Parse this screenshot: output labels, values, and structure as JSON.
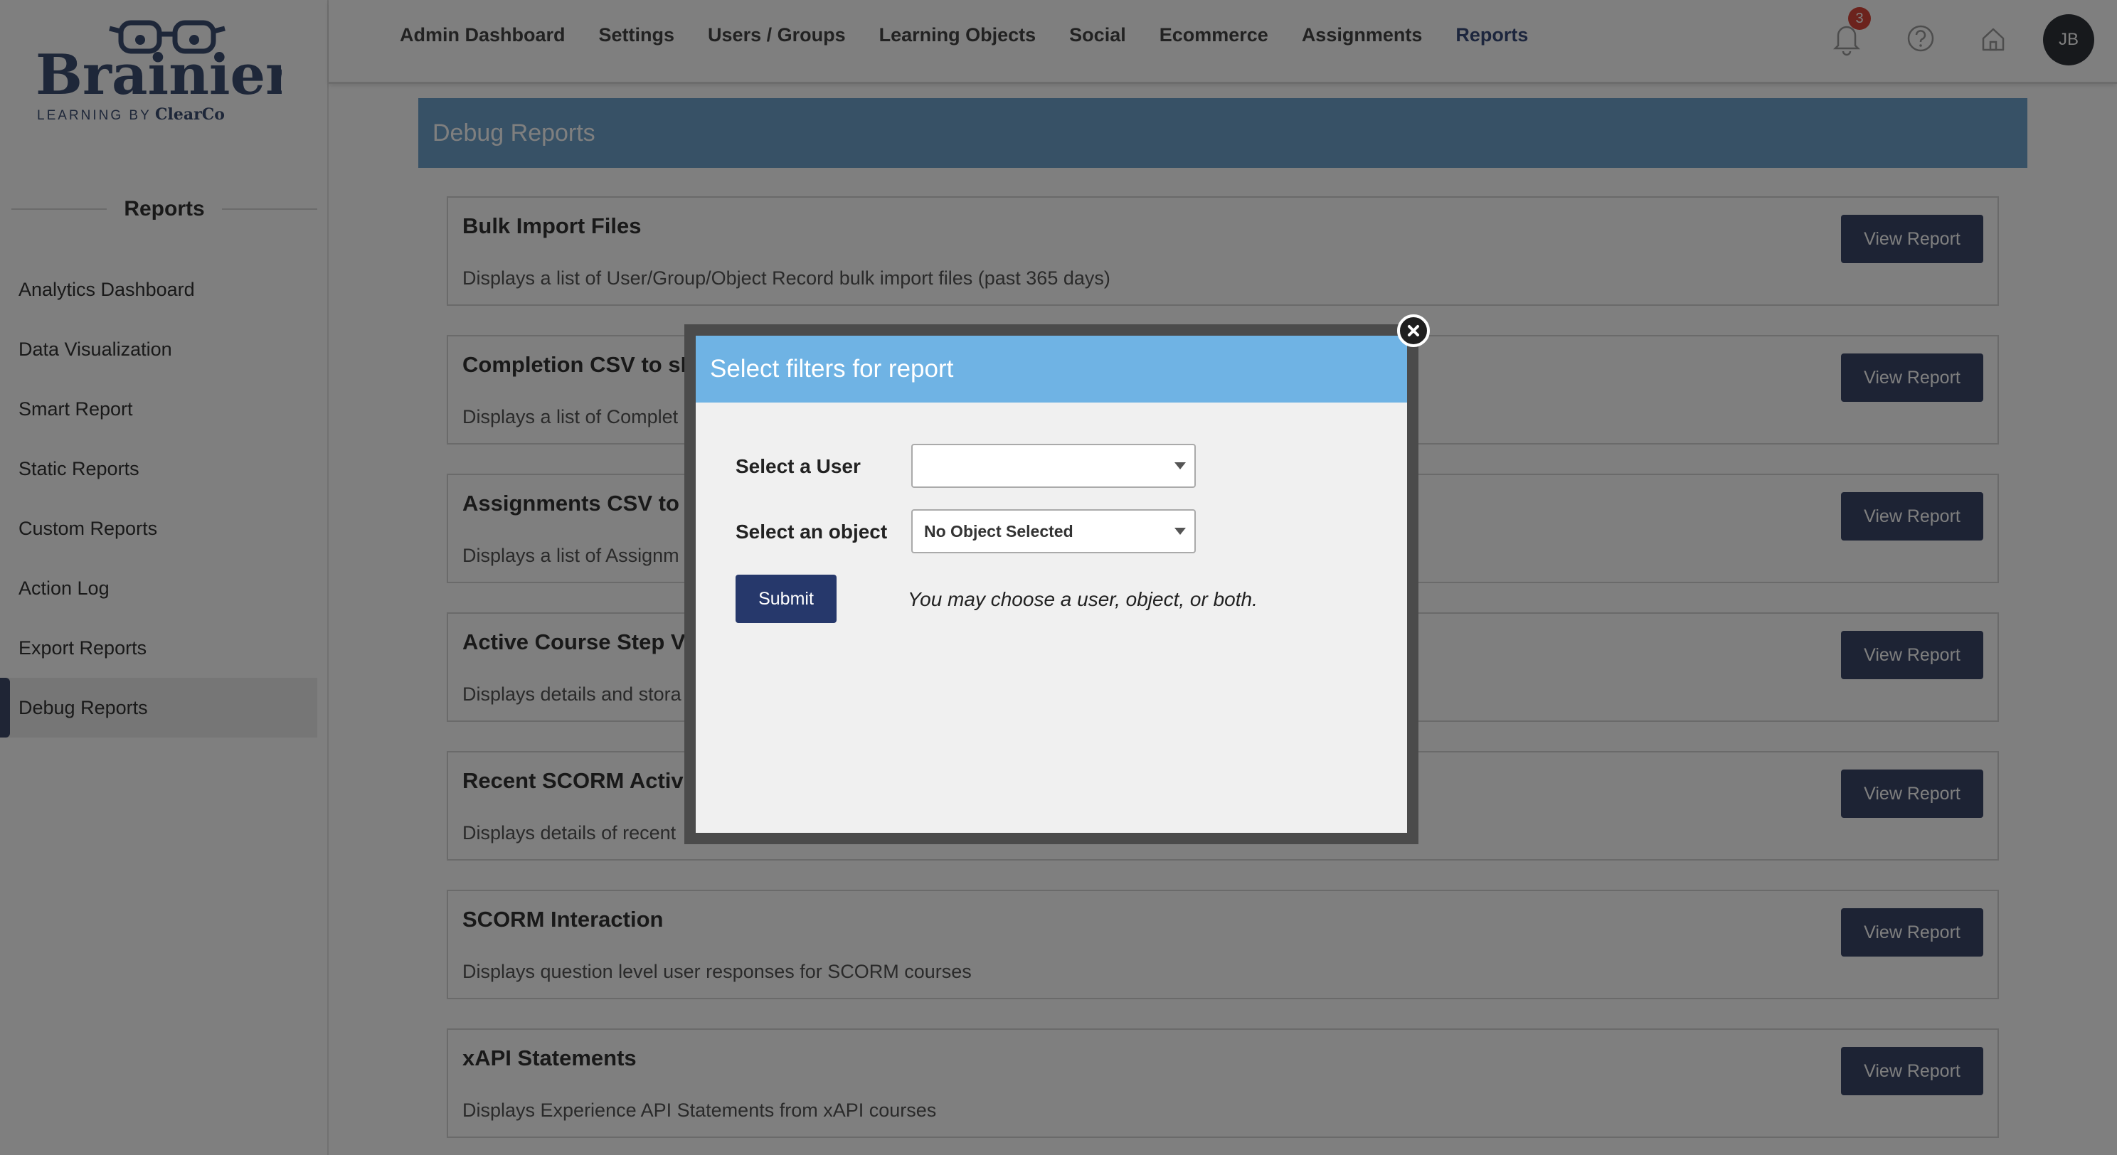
{
  "brand": {
    "name": "Brainier",
    "tagline": "LEARNING BY",
    "company": "ClearCo",
    "colors": {
      "primary": "#3a4768",
      "header": "#6fa3cc",
      "modal_header": "#6fb3e4",
      "badge": "#d9463a"
    }
  },
  "sidebar": {
    "heading": "Reports",
    "items": [
      {
        "label": "Analytics Dashboard"
      },
      {
        "label": "Data Visualization"
      },
      {
        "label": "Smart Report"
      },
      {
        "label": "Static Reports"
      },
      {
        "label": "Custom Reports"
      },
      {
        "label": "Action Log"
      },
      {
        "label": "Export Reports"
      },
      {
        "label": "Debug Reports",
        "active": true
      }
    ]
  },
  "topnav": {
    "items": [
      {
        "label": "Admin Dashboard"
      },
      {
        "label": "Settings"
      },
      {
        "label": "Users / Groups"
      },
      {
        "label": "Learning Objects"
      },
      {
        "label": "Social"
      },
      {
        "label": "Ecommerce"
      },
      {
        "label": "Assignments"
      },
      {
        "label": "Reports",
        "active": true
      }
    ],
    "notifications_count": "3",
    "icons": [
      "bell-icon",
      "help-icon",
      "home-icon"
    ],
    "avatar_initials": "JB"
  },
  "page": {
    "title": "Debug Reports",
    "reports": [
      {
        "title": "Bulk Import Files",
        "desc": "Displays a list of User/Group/Object Record bulk import files (past 365 days)",
        "button": "View Report"
      },
      {
        "title": "Completion CSV to sF",
        "desc": "Displays a list of Complet",
        "button": "View Report"
      },
      {
        "title": "Assignments CSV to s",
        "desc": "Displays a list of Assignm",
        "button": "View Report"
      },
      {
        "title": "Active Course Step Vi",
        "desc": "Displays details and stora",
        "button": "View Report"
      },
      {
        "title": "Recent SCORM Activit",
        "desc": "Displays details of recent",
        "button": "View Report"
      },
      {
        "title": "SCORM Interaction",
        "desc": "Displays question level user responses for SCORM courses",
        "button": "View Report"
      },
      {
        "title": "xAPI Statements",
        "desc": "Displays Experience API Statements from xAPI courses",
        "button": "View Report"
      }
    ]
  },
  "modal": {
    "title": "Select filters for report",
    "user_label": "Select a User",
    "user_value": "",
    "object_label": "Select an object",
    "object_value": "No Object Selected",
    "submit_label": "Submit",
    "hint": "You may choose a user, object, or both."
  }
}
